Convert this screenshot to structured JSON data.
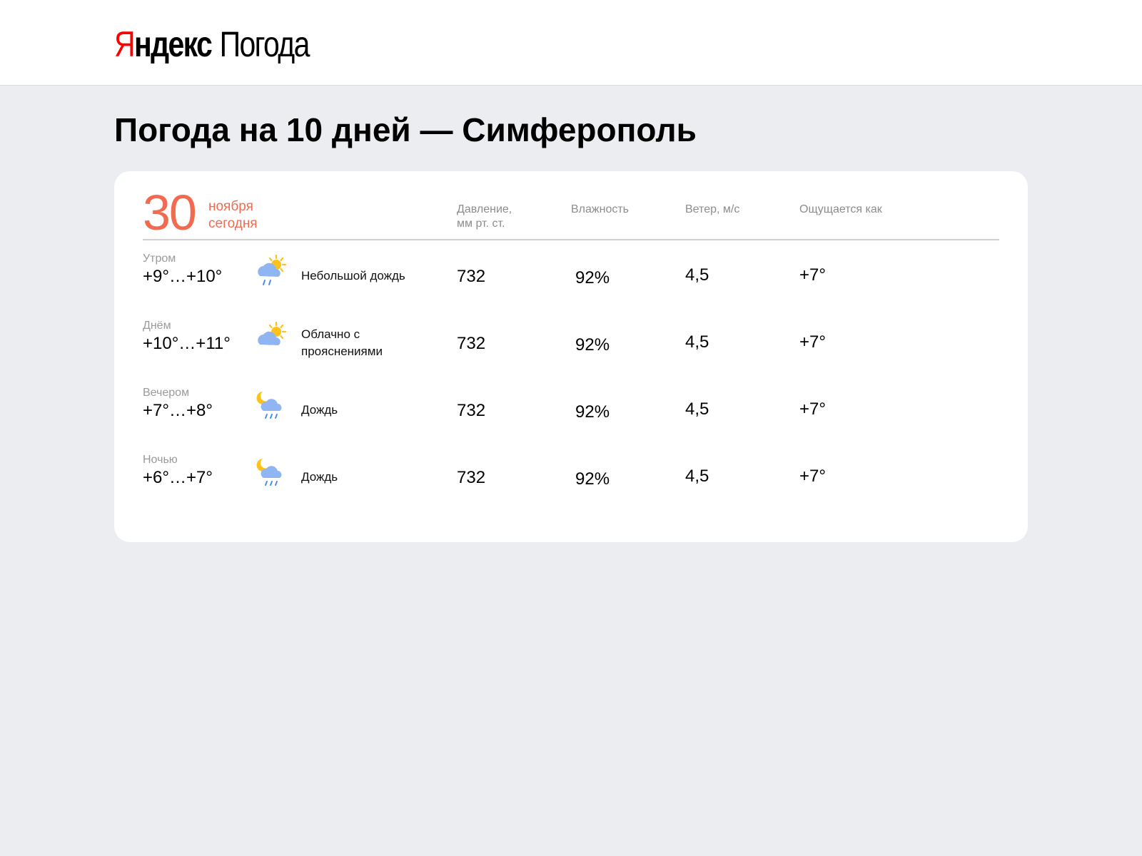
{
  "header": {
    "logo_first_letter": "Я",
    "logo_rest": "ндекс",
    "product": "Погода"
  },
  "page_title": "Погода на 10 дней — Симферополь",
  "date": {
    "day": "30",
    "month": "ноября",
    "relative": "сегодня"
  },
  "columns": {
    "pressure_line1": "Давление,",
    "pressure_line2": "мм рт. ст.",
    "humidity": "Влажность",
    "wind": "Ветер, м/с",
    "feels_like": "Ощущается как"
  },
  "rows": [
    {
      "part": "Утром",
      "temp": "+9°…+10°",
      "icon": "cloud-sun-rain-icon",
      "condition": "Небольшой дождь",
      "pressure": "732",
      "humidity": "92%",
      "wind": "4,5",
      "feels_like": "+7°"
    },
    {
      "part": "Днём",
      "temp": "+10°…+11°",
      "icon": "cloud-sun-icon",
      "condition": "Облачно с прояснениями",
      "pressure": "732",
      "humidity": "92%",
      "wind": "4,5",
      "feels_like": "+7°"
    },
    {
      "part": "Вечером",
      "temp": "+7°…+8°",
      "icon": "cloud-moon-rain-icon",
      "condition": "Дождь",
      "pressure": "732",
      "humidity": "92%",
      "wind": "4,5",
      "feels_like": "+7°"
    },
    {
      "part": "Ночью",
      "temp": "+6°…+7°",
      "icon": "cloud-moon-rain-icon",
      "condition": "Дождь",
      "pressure": "732",
      "humidity": "92%",
      "wind": "4,5",
      "feels_like": "+7°"
    }
  ],
  "colors": {
    "accent_date": "#f26a4f",
    "logo_red": "#ff0000",
    "page_bg": "#ebedf1",
    "muted_text": "#8c8c8c",
    "cloud": "#8fb6f2",
    "sun": "#ffc21a",
    "rain": "#4a8fe0"
  }
}
